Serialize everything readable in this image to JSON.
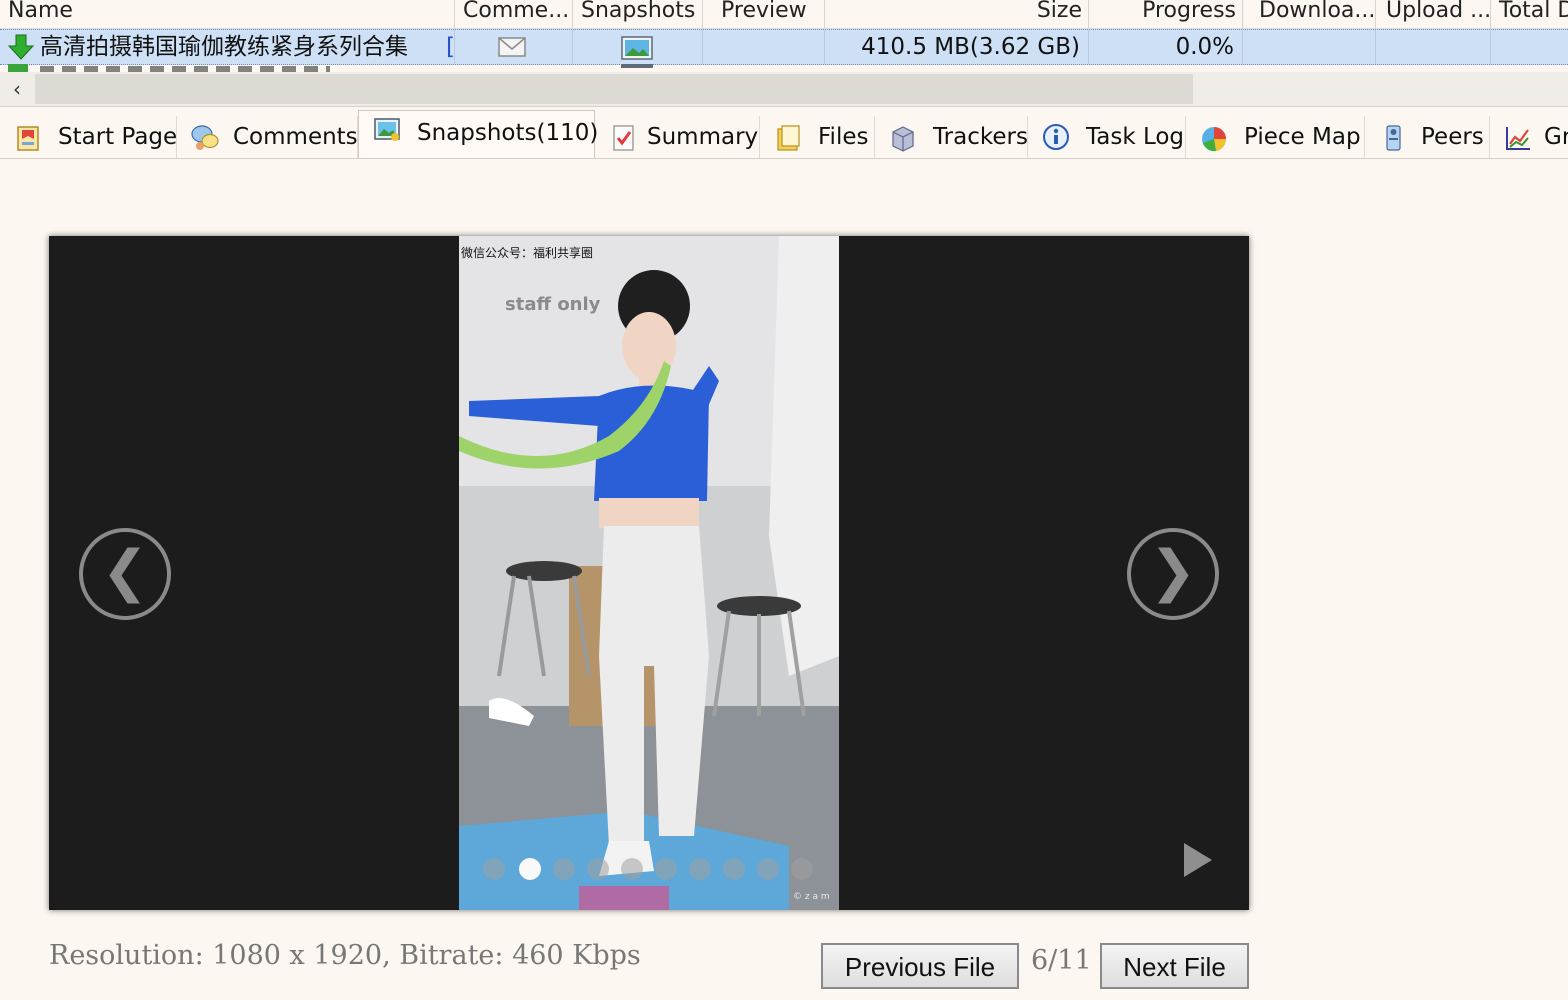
{
  "columns": {
    "name": "Name",
    "comments": "Comme...",
    "snapshots": "Snapshots",
    "preview": "Preview",
    "size": "Size",
    "progress": "Progress",
    "download": "Downloa...",
    "upload": "Upload ...",
    "total": "Total D"
  },
  "task": {
    "name": "高清拍摄韩国瑜伽教练紧身系列合集",
    "name_suffix": "[",
    "size": "410.5 MB(3.62 GB)",
    "progress": "0.0%"
  },
  "scroll": {
    "left_arrow": "‹"
  },
  "tabs": [
    {
      "label": "Start Page",
      "icon": "start-page-icon"
    },
    {
      "label": "Comments",
      "icon": "comments-icon"
    },
    {
      "label": "Snapshots(110)",
      "icon": "snapshots-icon",
      "active": true
    },
    {
      "label": "Summary",
      "icon": "summary-icon"
    },
    {
      "label": "Files",
      "icon": "files-icon"
    },
    {
      "label": "Trackers",
      "icon": "trackers-icon"
    },
    {
      "label": "Task Log",
      "icon": "task-log-icon"
    },
    {
      "label": "Piece Map",
      "icon": "piece-map-icon"
    },
    {
      "label": "Peers",
      "icon": "peers-icon"
    },
    {
      "label": "Gr",
      "icon": "graph-icon"
    }
  ],
  "viewer": {
    "prev_glyph": "❮",
    "next_glyph": "❯",
    "watermark_text": "微信公众号：福利共享圈",
    "wall_text": "staff only",
    "corner_mark": "© z a m",
    "dots_count": 10,
    "active_dot": 2
  },
  "footer": {
    "info": "Resolution: 1080 x 1920, Bitrate: 460 Kbps",
    "prev_button": "Previous File",
    "counter": "6/11",
    "next_button": "Next File"
  }
}
